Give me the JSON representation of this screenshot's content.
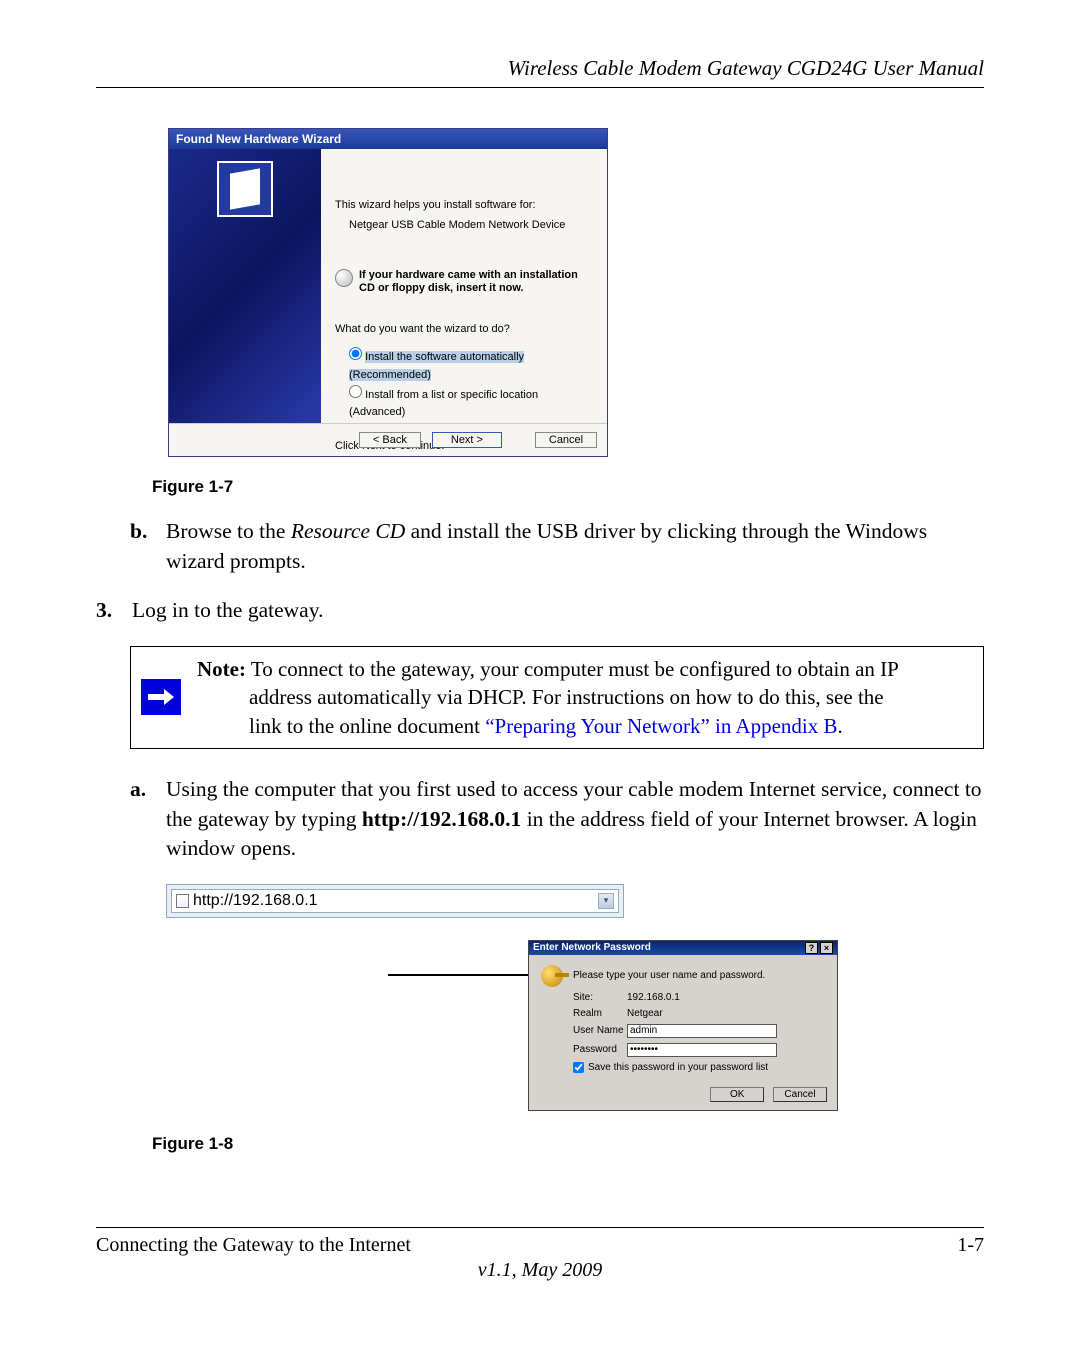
{
  "header": {
    "title": "Wireless Cable Modem Gateway CGD24G User Manual"
  },
  "wizard": {
    "title": "Found New Hardware Wizard",
    "intro": "This wizard helps you install software for:",
    "device": "Netgear USB Cable Modem Network Device",
    "cd_note": "If your hardware came with an installation CD or floppy disk, insert it now.",
    "question": "What do you want the wizard to do?",
    "option_auto": "Install the software automatically (Recommended)",
    "option_list": "Install from a list or specific location (Advanced)",
    "continue_text": "Click Next to continue.",
    "buttons": {
      "back": "< Back",
      "next": "Next >",
      "cancel": "Cancel"
    }
  },
  "figure7_caption": "Figure 1-7",
  "item_b": {
    "label": "b.",
    "text_pre": "Browse to the ",
    "resource_cd": "Resource CD",
    "text_post": " and install the USB driver by clicking through the Windows wizard prompts."
  },
  "item_3": {
    "label": "3.",
    "text": "Log in to the gateway."
  },
  "note": {
    "label": "Note:",
    "line1": " To connect to the gateway, your computer must be configured to obtain an IP",
    "line2": "address automatically via DHCP. For instructions on how to do this, see the",
    "line3a": "link to the online document ",
    "link": "“Preparing Your Network” in Appendix B",
    "period": "."
  },
  "item_a": {
    "label": "a.",
    "text_pre": "Using the computer that you first used to access your cable modem Internet service, connect to the gateway by typing ",
    "bold_url": "http://192.168.0.1",
    "text_post": " in the address field of your Internet browser. A login window opens."
  },
  "address_bar": {
    "url": "http://192.168.0.1"
  },
  "login": {
    "title": "Enter Network Password",
    "prompt": "Please type your user name and password.",
    "site_label": "Site:",
    "site_value": "192.168.0.1",
    "realm_label": "Realm",
    "realm_value": "Netgear",
    "username_label": "User Name",
    "username_value": "admin",
    "password_label": "Password",
    "password_value": "••••••••",
    "save_label": "Save this password in your password list",
    "ok": "OK",
    "cancel": "Cancel"
  },
  "figure8_caption": "Figure 1-8",
  "footer": {
    "chapter": "Connecting the Gateway to the Internet",
    "pagenum": "1-7",
    "version": "v1.1, May 2009"
  }
}
